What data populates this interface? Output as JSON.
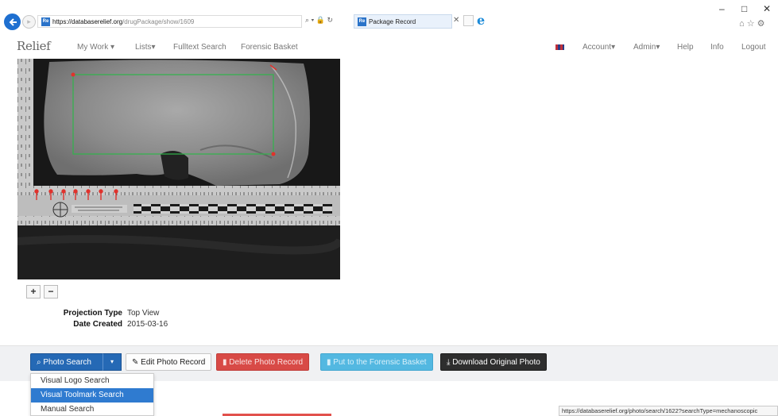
{
  "browser": {
    "url_host": "https://databaserelief.org",
    "url_path": "/drugPackage/show/1609",
    "address_tools": "⌕ ▾ 🔒 ↻",
    "tab_title": "Package Record",
    "tab_favicon": "Re",
    "minimize": "–",
    "maximize": "□",
    "close": "✕",
    "right_icons": "⌂ ☆ ⚙",
    "ie_icon": "e"
  },
  "navbar": {
    "logo": "Relief",
    "items": [
      "My Work ▾",
      "Lists▾",
      "Fulltext Search",
      "Forensic Basket"
    ],
    "right_items": [
      "Account▾",
      "Admin▾",
      "Help",
      "Info",
      "Logout"
    ]
  },
  "zoom": {
    "plus": "+",
    "minus": "−"
  },
  "metadata": {
    "projection_label": "Projection Type",
    "projection_value": "Top View",
    "date_label": "Date Created",
    "date_value": "2015-03-16"
  },
  "toolbar": {
    "photo_search": "⌕ Photo Search",
    "caret": "▾",
    "edit": "✎ Edit Photo Record",
    "delete": "▮ Delete Photo Record",
    "basket": "▮ Put to the Forensic Basket",
    "download": "⤓ Download Original Photo"
  },
  "dropdown": {
    "items": [
      "Visual Logo Search",
      "Visual Toolmark Search",
      "Manual Search"
    ],
    "active_index": 1
  },
  "status_url": "https://databaserelief.org/photo/search/1622?searchType=mechanoscopic",
  "colors": {
    "primary": "#2569b5",
    "danger": "#d84a46",
    "info": "#53b8e1",
    "dark": "#2e2e2e",
    "marker_red": "#e0322c",
    "roi_green": "#2fb54a"
  }
}
